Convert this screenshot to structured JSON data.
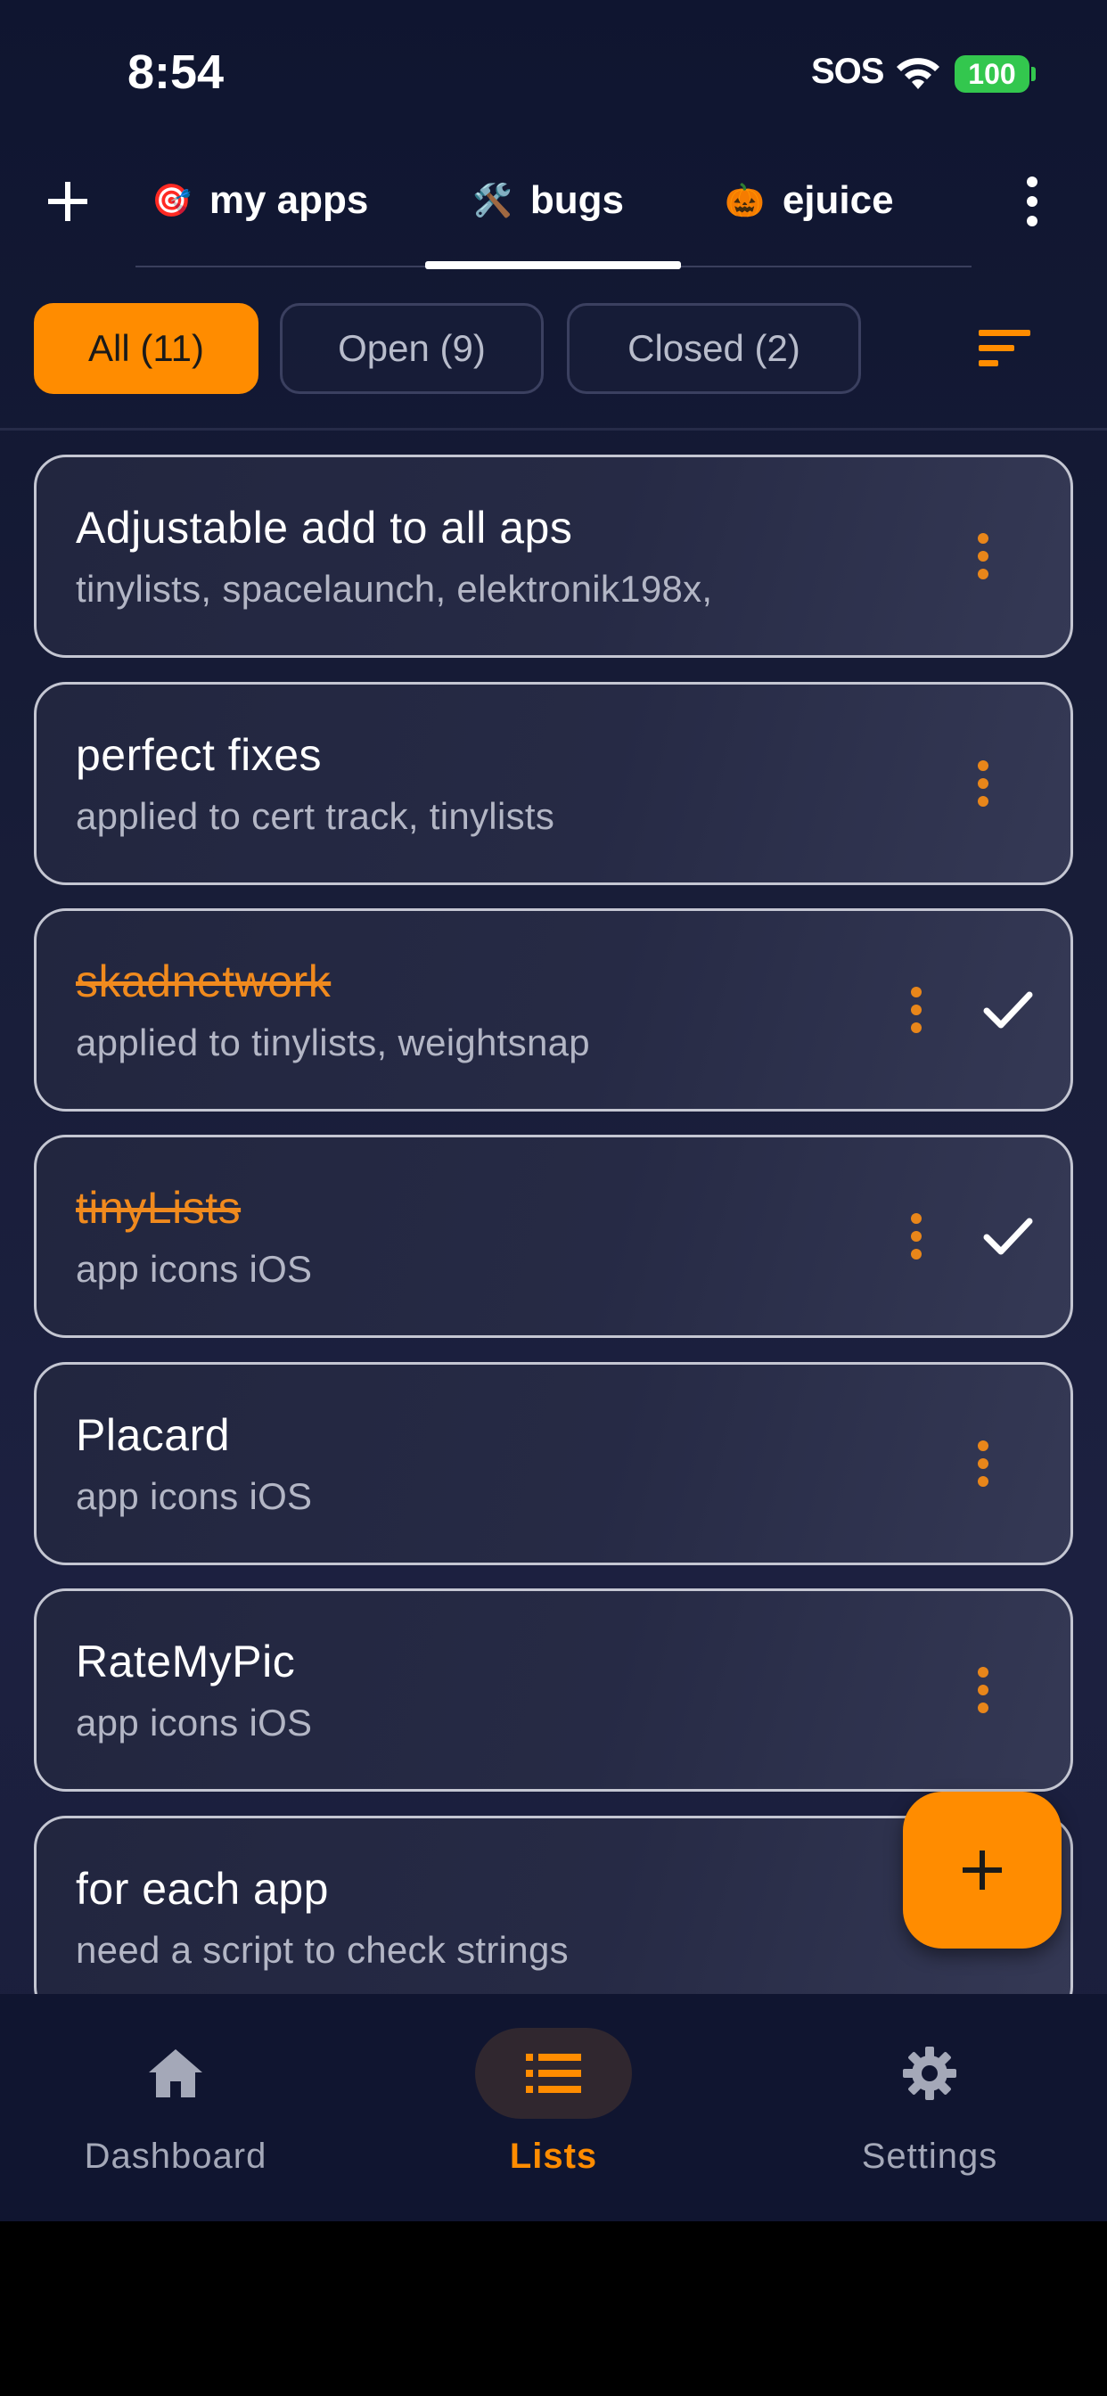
{
  "status_bar": {
    "time": "8:54",
    "sos": "SOS",
    "battery": "100"
  },
  "top_tabs": [
    {
      "emoji": "🎯",
      "label": "my apps",
      "selected": false
    },
    {
      "emoji": "🛠️",
      "label": "bugs",
      "selected": true
    },
    {
      "emoji": "🎃",
      "label": "ejuice",
      "selected": false
    }
  ],
  "filters": {
    "all": "All (11)",
    "open": "Open (9)",
    "closed": "Closed (2)",
    "selected": "all"
  },
  "items": [
    {
      "title": "Adjustable add to all aps",
      "subtitle": "tinylists, spacelaunch, elektronik198x,",
      "done": false
    },
    {
      "title": "perfect fixes",
      "subtitle": "applied to cert track, tinylists",
      "done": false
    },
    {
      "title": "skadnetwork",
      "subtitle": "applied to tinylists, weightsnap",
      "done": true
    },
    {
      "title": "tinyLists",
      "subtitle": "app icons iOS",
      "done": true
    },
    {
      "title": "Placard",
      "subtitle": "app icons iOS",
      "done": false
    },
    {
      "title": "RateMyPic",
      "subtitle": "app icons iOS",
      "done": false
    },
    {
      "title": "for each app",
      "subtitle": "need a script to check strings",
      "done": false
    }
  ],
  "bottom_nav": {
    "dashboard": "Dashboard",
    "lists": "Lists",
    "settings": "Settings",
    "active": "lists"
  },
  "colors": {
    "accent": "#ff8c00",
    "background": "#181d38",
    "card_border": "#c4c6d2",
    "done_text": "#f08a1e"
  },
  "icons": [
    "plus-icon",
    "more-vert-icon",
    "sort-icon",
    "check-icon",
    "home-icon",
    "list-icon",
    "gear-icon",
    "wifi-icon",
    "battery-icon"
  ]
}
